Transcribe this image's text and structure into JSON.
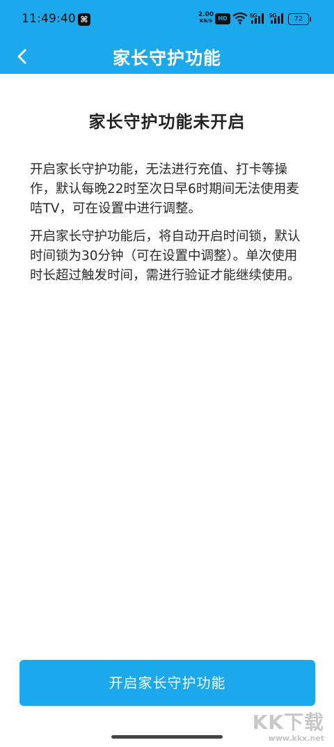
{
  "status_bar": {
    "time": "11:49:40",
    "net_speed_value": "2.00",
    "net_speed_unit": "KB/S",
    "hd_label": "HD",
    "signal1_label": "5G",
    "signal2_label": "5G",
    "battery": "72"
  },
  "header": {
    "title": "家长守护功能",
    "back_icon": "chevron-left-icon"
  },
  "content": {
    "heading": "家长守护功能未开启",
    "paragraph1": "开启家长守护功能，无法进行充值、打卡等操作，默认每晚22时至次日早6时期间无法使用麦咭TV，可在设置中进行调整。",
    "paragraph2": "开启家长守护功能后，将自动开启时间锁，默认时间锁为30分钟（可在设置中调整）。单次使用时长超过触发时间，需进行验证才能继续使用。"
  },
  "actions": {
    "enable_label": "开启家长守护功能"
  },
  "watermark": {
    "logo": "KK下载",
    "url": "www.kkx.net"
  },
  "colors": {
    "accent": "#1ba9ec"
  }
}
